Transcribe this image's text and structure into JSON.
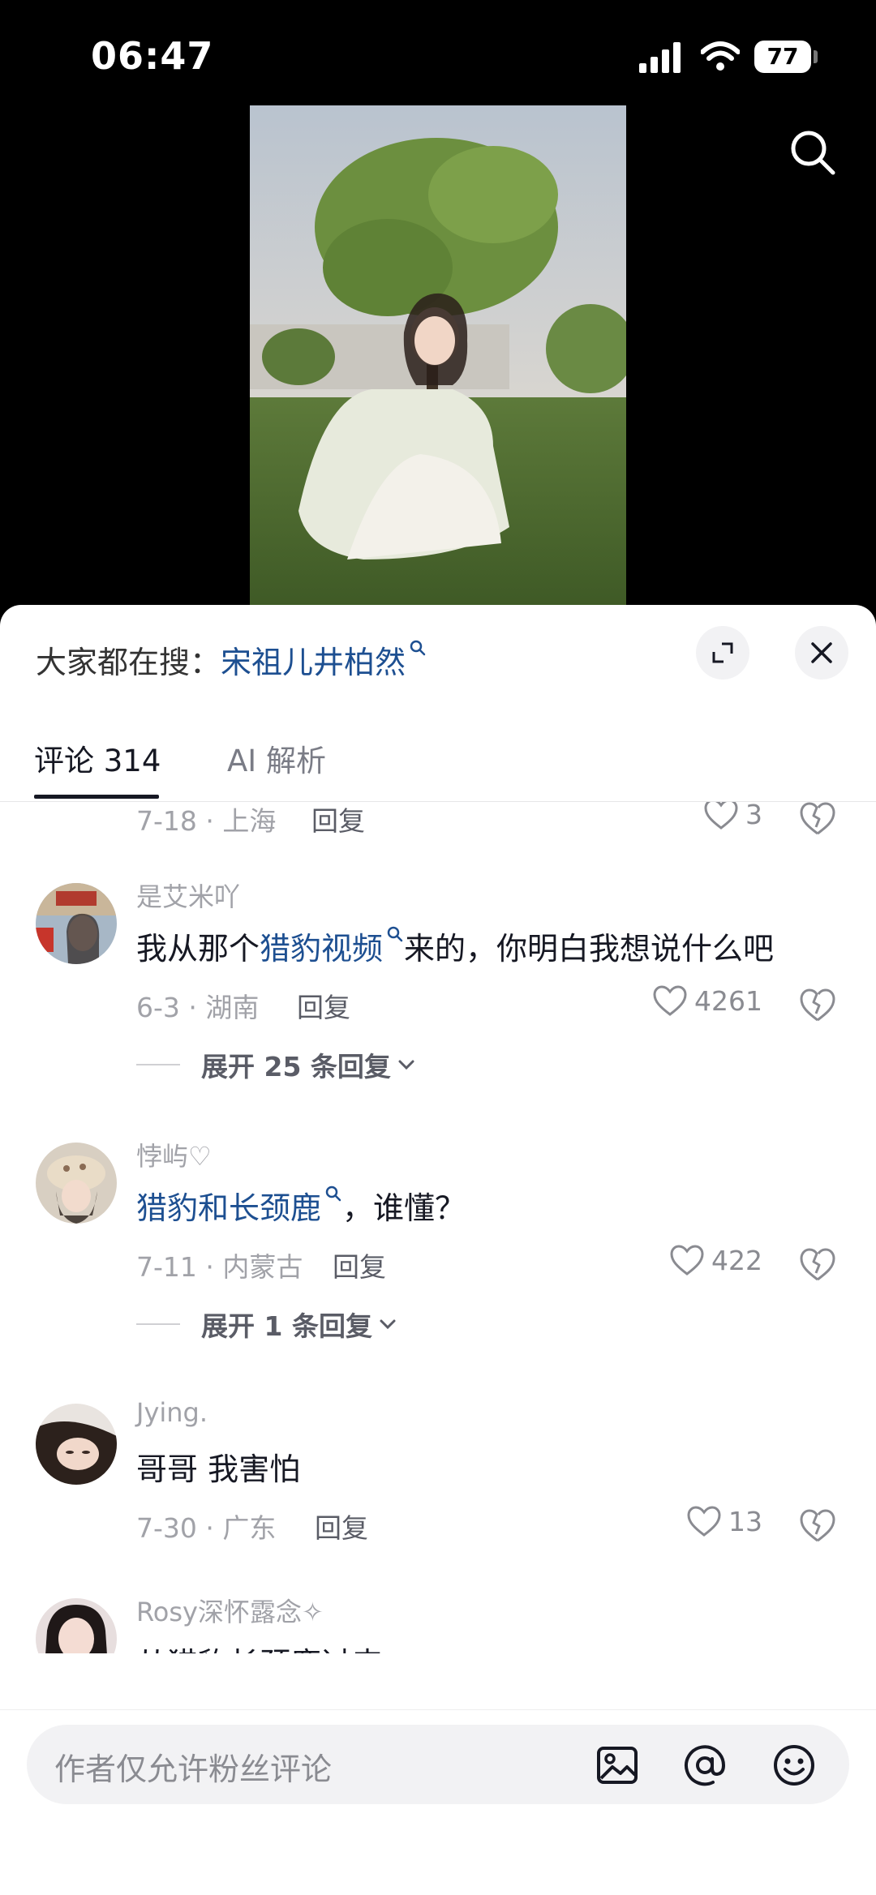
{
  "status_bar": {
    "time": "06:47",
    "battery": "77"
  },
  "hot_search": {
    "prefix": "大家都在搜：",
    "keyword": "宋祖儿井柏然"
  },
  "tabs": [
    {
      "label": "评论 314"
    },
    {
      "label": "AI 解析"
    }
  ],
  "partial_comment": {
    "meta": "7-18 · 上海",
    "reply": "回复",
    "likes": "3"
  },
  "comments": [
    {
      "user": "是艾米吖",
      "text_parts": [
        "我从那个",
        "猎豹视频",
        "来的，你明白我想说什么吧"
      ],
      "meta": "6-3 · 湖南",
      "reply": "回复",
      "likes": "4261",
      "expand": "展开 25 条回复"
    },
    {
      "user": "悖屿♡",
      "text_parts": [
        "猎豹和长颈鹿",
        "，谁懂？"
      ],
      "meta": "7-11 · 内蒙古",
      "reply": "回复",
      "likes": "422",
      "expand": "展开 1 条回复"
    },
    {
      "user": "Jying.",
      "text": "哥哥 我害怕",
      "meta": "7-30 · 广东",
      "reply": "回复",
      "likes": "13"
    },
    {
      "user": "Rosy深怀露念✧",
      "text": "从猎豹长颈鹿过来"
    }
  ],
  "input": {
    "placeholder": "作者仅允许粉丝评论"
  },
  "colors": {
    "keyword": "#1d4f91",
    "text": "#161823",
    "muted": "#a1a2a8"
  }
}
